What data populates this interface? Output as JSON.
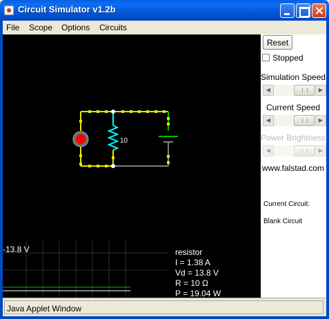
{
  "window": {
    "title": "Circuit Simulator v1.2b"
  },
  "menu": [
    "File",
    "Scope",
    "Options",
    "Circuits"
  ],
  "circuit": {
    "resistor_label": "10"
  },
  "scope": {
    "voltage_label": "-13.8 V"
  },
  "info": {
    "lines": [
      "resistor",
      "I = 1.38 A",
      "Vd = 13.8 V",
      "R = 10 Ω",
      "P = 19.04 W"
    ]
  },
  "sidebar": {
    "reset_label": "Reset",
    "stopped_label": "Stopped",
    "stopped_checked": false,
    "sim_speed_label": "Simulation Speed",
    "current_speed_label": "Current Speed",
    "power_brightness_label": "Power Brightness",
    "website": "www.falstad.com",
    "current_circuit_label": "Current Circuit:",
    "current_circuit_name": "Blank Circuit"
  },
  "status": {
    "text": "Java Applet Window"
  },
  "colors": {
    "wire_current": "#e5e500",
    "wire_live": "#00c000",
    "wire_ground": "#808080",
    "resistor": "#00ffff",
    "lamp": "#ff0000",
    "titlebar": "#0456d6"
  }
}
